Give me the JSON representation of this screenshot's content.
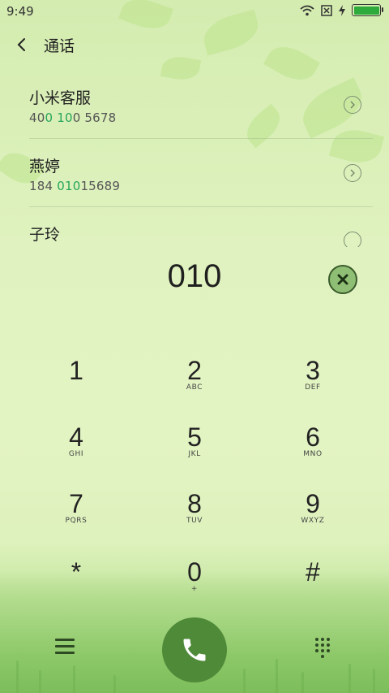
{
  "status_bar": {
    "time": "9:49"
  },
  "header": {
    "title": "通话"
  },
  "contacts": [
    {
      "name": "小米客服",
      "number_parts": [
        "40",
        "0 10",
        "0 5678"
      ]
    },
    {
      "name": "燕婷",
      "number_parts": [
        "184 ",
        "010",
        "15689"
      ]
    },
    {
      "name": "子玲"
    }
  ],
  "dialed_number": "010",
  "keypad": [
    {
      "digit": "1",
      "letters": ""
    },
    {
      "digit": "2",
      "letters": "ABC"
    },
    {
      "digit": "3",
      "letters": "DEF"
    },
    {
      "digit": "4",
      "letters": "GHI"
    },
    {
      "digit": "5",
      "letters": "JKL"
    },
    {
      "digit": "6",
      "letters": "MNO"
    },
    {
      "digit": "7",
      "letters": "PQRS"
    },
    {
      "digit": "8",
      "letters": "TUV"
    },
    {
      "digit": "9",
      "letters": "WXYZ"
    },
    {
      "digit": "*",
      "letters": ""
    },
    {
      "digit": "0",
      "letters": "+"
    },
    {
      "digit": "#",
      "letters": ""
    }
  ],
  "colors": {
    "highlight": "#27a55a",
    "call_button": "#4f8a39",
    "battery": "#2faa3c"
  },
  "battery_level": 1.0
}
